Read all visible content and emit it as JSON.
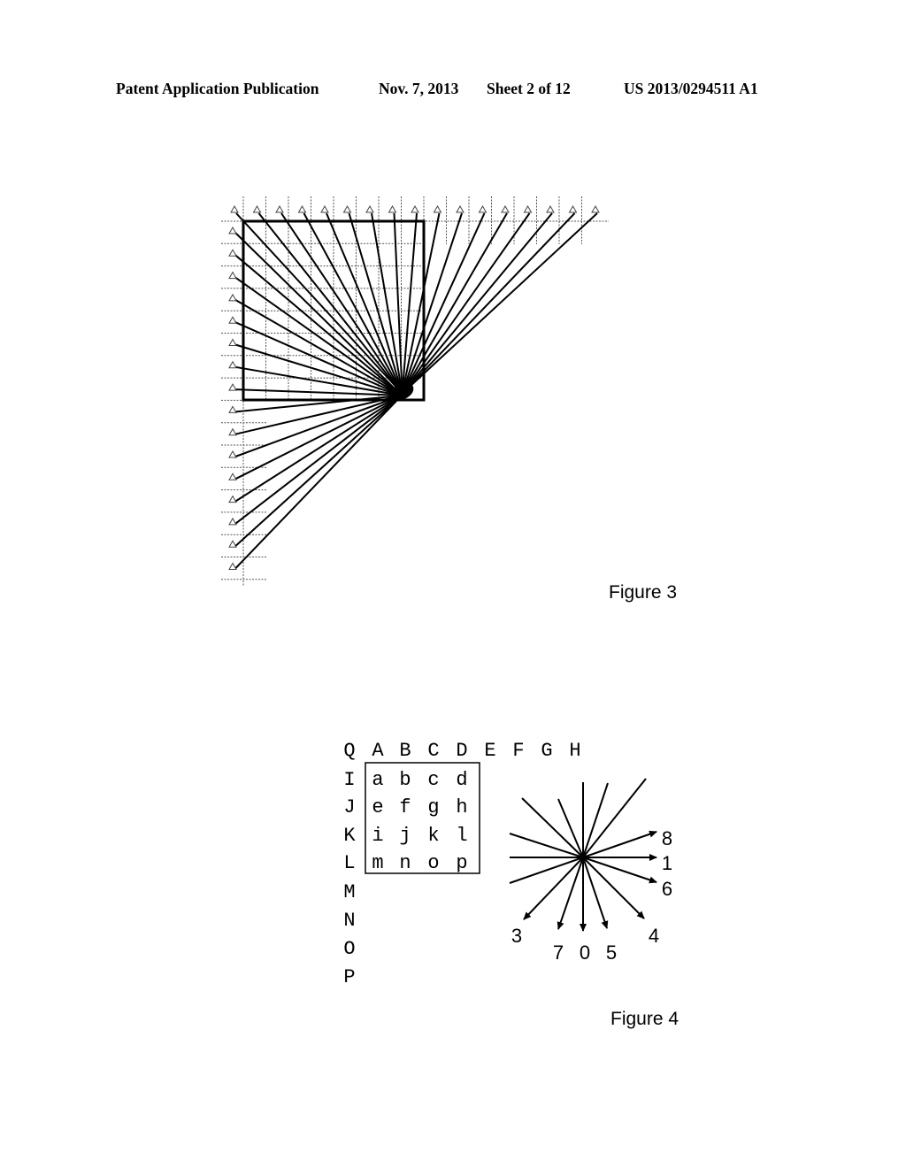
{
  "header": {
    "publication": "Patent Application Publication",
    "date": "Nov. 7, 2013",
    "sheet": "Sheet 2 of 12",
    "number": "US 2013/0294511 A1"
  },
  "figure3": {
    "caption": "Figure 3",
    "block_cells": 8,
    "top_reference_markers": 17,
    "left_reference_markers": 16,
    "description": "Projection lines from top and left reference samples converging at the lower-right corner of an 8x8 block"
  },
  "figure4": {
    "caption": "Figure 4",
    "top_row_labels": [
      "Q",
      "A",
      "B",
      "C",
      "D",
      "E",
      "F",
      "G",
      "H"
    ],
    "left_column_labels": [
      "I",
      "J",
      "K",
      "L",
      "M",
      "N",
      "O",
      "P"
    ],
    "block_cells": [
      [
        "a",
        "b",
        "c",
        "d"
      ],
      [
        "e",
        "f",
        "g",
        "h"
      ],
      [
        "i",
        "j",
        "k",
        "l"
      ],
      [
        "m",
        "n",
        "o",
        "p"
      ]
    ],
    "direction_labels": [
      {
        "label": "8",
        "mode": "8"
      },
      {
        "label": "1",
        "mode": "1"
      },
      {
        "label": "6",
        "mode": "6"
      },
      {
        "label": "4",
        "mode": "4"
      },
      {
        "label": "5",
        "mode": "5"
      },
      {
        "label": "0",
        "mode": "0"
      },
      {
        "label": "7",
        "mode": "7"
      },
      {
        "label": "3",
        "mode": "3"
      }
    ]
  }
}
